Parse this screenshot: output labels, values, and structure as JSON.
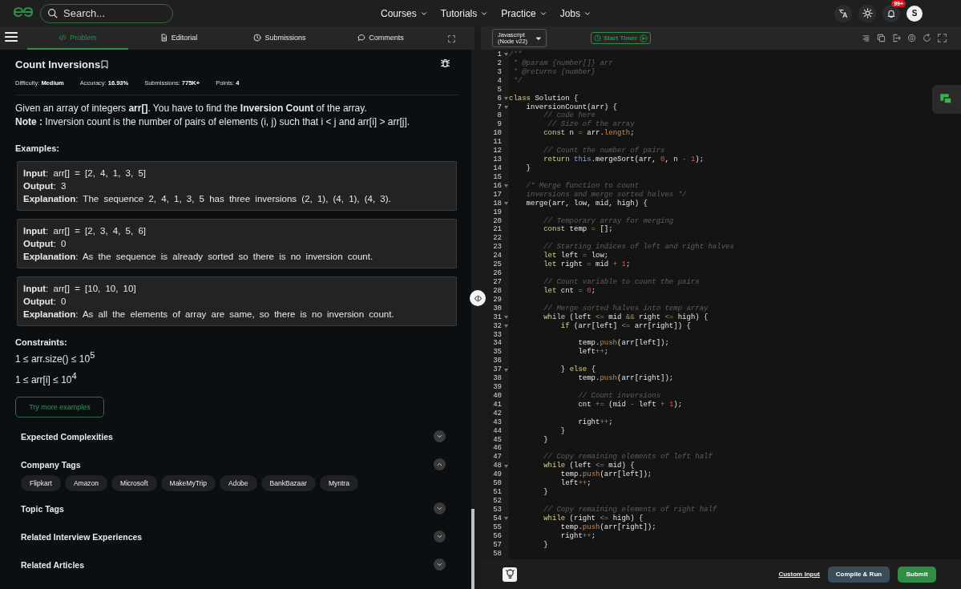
{
  "header": {
    "search": {
      "placeholder": "Search..."
    },
    "nav": [
      "Courses",
      "Tutorials",
      "Practice",
      "Jobs"
    ],
    "notifications_badge": "99+",
    "avatar": "S"
  },
  "problem_tabs": [
    {
      "label": "Problem",
      "selected": true,
      "kind": "code"
    },
    {
      "label": "Editorial",
      "selected": false,
      "kind": "doc"
    },
    {
      "label": "Submissions",
      "selected": false,
      "kind": "clock"
    },
    {
      "label": "Comments",
      "selected": false,
      "kind": "chat"
    }
  ],
  "problem": {
    "title": "Count Inversions",
    "meta": [
      "Difficulty: **Medium**",
      "Accuracy: **16.93%**",
      "Submissions: **775K+**",
      "Points: **4**"
    ],
    "description": [
      "Given an array of integers **arr[]**. You have to find the **Inversion Count** of the array.",
      "**Note :** Inversion count is the number of pairs of elements (i, j) such that i < j and arr[i] > arr[j]."
    ],
    "examples_heading": "Examples:",
    "examples": [
      [
        "**Input**: arr[] = [2, 4, 1, 3, 5]",
        "**Output**: 3",
        "**Explanation**: The sequence 2, 4, 1, 3, 5 has three inversions (2, 1), (4, 1), (4, 3)."
      ],
      [
        "**Input**: arr[] = [2, 3, 4, 5, 6]",
        "**Output**: 0",
        "**Explanation**: As the sequence is already sorted so there is no inversion count."
      ],
      [
        "**Input**: arr[] = [10, 10, 10]",
        "**Output**: 0",
        "**Explanation**: As all the elements of array are same, so there is no inversion count."
      ]
    ],
    "constraints_heading": "Constraints:",
    "constraints": [
      "1 ≤ arr.size() ≤ 10$^{5}$",
      "1 ≤ arr[i] ≤ 10$^{4}$"
    ],
    "try_button": "Try more examples",
    "sections": [
      {
        "title": "Expected Complexities",
        "expanded": false
      },
      {
        "title": "Company Tags",
        "expanded": true,
        "tags": [
          "Flipkart",
          "Amazon",
          "Microsoft",
          "MakeMyTrip",
          "Adobe",
          "BankBazaar",
          "Myntra"
        ]
      },
      {
        "title": "Topic Tags",
        "expanded": false
      },
      {
        "title": "Related Interview Experiences",
        "expanded": false
      },
      {
        "title": "Related Articles",
        "expanded": false
      }
    ]
  },
  "editor": {
    "language": "Javascript (Node v22)",
    "timer_button": "Start Timer",
    "lines": [
      {
        "number": "1",
        "foldable": true,
        "tokens": [
          {
            "text": "/**",
            "kind": "comment"
          }
        ]
      },
      {
        "number": "2",
        "foldable": false,
        "tokens": [
          {
            "text": " * @param {number[]} arr",
            "kind": "comment"
          }
        ]
      },
      {
        "number": "3",
        "foldable": false,
        "tokens": [
          {
            "text": " * @returns {number}",
            "kind": "comment"
          }
        ]
      },
      {
        "number": "4",
        "foldable": false,
        "tokens": [
          {
            "text": " */",
            "kind": "comment"
          }
        ]
      },
      {
        "number": "5",
        "foldable": false
      },
      {
        "number": "6",
        "foldable": true,
        "tokens": [
          {
            "text": "class",
            "kind": "keyword"
          },
          {
            "text": " Solution {"
          }
        ]
      },
      {
        "number": "7",
        "foldable": true,
        "tokens": [
          {
            "text": "    inversionCount(arr) {"
          }
        ]
      },
      {
        "number": "8",
        "foldable": false,
        "tokens": [
          {
            "text": "        // code here",
            "kind": "comment"
          }
        ]
      },
      {
        "number": "9",
        "foldable": false,
        "tokens": [
          {
            "text": "         // Size of the array",
            "kind": "comment"
          }
        ]
      },
      {
        "number": "10",
        "foldable": false,
        "tokens": [
          {
            "text": "        const",
            "kind": "keyword"
          },
          {
            "text": " n "
          },
          {
            "text": "=",
            "kind": "operator"
          },
          {
            "text": " arr."
          },
          {
            "text": "length",
            "kind": "member"
          },
          {
            "text": ";"
          }
        ]
      },
      {
        "number": "11",
        "foldable": false
      },
      {
        "number": "12",
        "foldable": false,
        "tokens": [
          {
            "text": "        // Count the number of pairs",
            "kind": "comment"
          }
        ]
      },
      {
        "number": "13",
        "foldable": false,
        "tokens": [
          {
            "text": "        return ",
            "kind": "keyword"
          },
          {
            "text": "this",
            "kind": "self"
          },
          {
            "text": ".mergeSort(arr, "
          },
          {
            "text": "0",
            "kind": "number"
          },
          {
            "text": ", n "
          },
          {
            "text": "- ",
            "kind": "operator"
          },
          {
            "text": "1",
            "kind": "number"
          },
          {
            "text": ");"
          }
        ]
      },
      {
        "number": "14",
        "foldable": false,
        "tokens": [
          {
            "text": "    }"
          }
        ]
      },
      {
        "number": "15",
        "foldable": false
      },
      {
        "number": "16",
        "foldable": true,
        "tokens": [
          {
            "text": "    /* Merge function to count",
            "kind": "comment"
          }
        ]
      },
      {
        "number": "17",
        "foldable": false,
        "tokens": [
          {
            "text": "    inversions and merge sorted halves */",
            "kind": "comment"
          }
        ]
      },
      {
        "number": "18",
        "foldable": true,
        "tokens": [
          {
            "text": "    merge(arr, low, mid, high) {"
          }
        ]
      },
      {
        "number": "19",
        "foldable": false
      },
      {
        "number": "20",
        "foldable": false,
        "tokens": [
          {
            "text": "        // Temporary array for merging",
            "kind": "comment"
          }
        ]
      },
      {
        "number": "21",
        "foldable": false,
        "tokens": [
          {
            "text": "        const",
            "kind": "keyword"
          },
          {
            "text": " temp "
          },
          {
            "text": "=",
            "kind": "operator"
          },
          {
            "text": " [];"
          }
        ]
      },
      {
        "number": "22",
        "foldable": false
      },
      {
        "number": "23",
        "foldable": false,
        "tokens": [
          {
            "text": "        // Starting indices of left and right halves",
            "kind": "comment"
          }
        ]
      },
      {
        "number": "24",
        "foldable": false,
        "tokens": [
          {
            "text": "        let",
            "kind": "keyword"
          },
          {
            "text": " left "
          },
          {
            "text": "=",
            "kind": "operator"
          },
          {
            "text": " low;"
          }
        ]
      },
      {
        "number": "25",
        "foldable": false,
        "tokens": [
          {
            "text": "        let",
            "kind": "keyword"
          },
          {
            "text": " right "
          },
          {
            "text": "=",
            "kind": "operator"
          },
          {
            "text": " mid "
          },
          {
            "text": "+ ",
            "kind": "operator"
          },
          {
            "text": "1",
            "kind": "number"
          },
          {
            "text": ";"
          }
        ]
      },
      {
        "number": "26",
        "foldable": false
      },
      {
        "number": "27",
        "foldable": false,
        "tokens": [
          {
            "text": "        // Count variable to count the pairs",
            "kind": "comment"
          }
        ]
      },
      {
        "number": "28",
        "foldable": false,
        "tokens": [
          {
            "text": "        let",
            "kind": "keyword"
          },
          {
            "text": " cnt "
          },
          {
            "text": "= ",
            "kind": "operator"
          },
          {
            "text": "0",
            "kind": "number"
          },
          {
            "text": ";"
          }
        ]
      },
      {
        "number": "29",
        "foldable": false
      },
      {
        "number": "30",
        "foldable": false,
        "tokens": [
          {
            "text": "        // Merge sorted halves into temp array",
            "kind": "comment"
          }
        ]
      },
      {
        "number": "31",
        "foldable": true,
        "tokens": [
          {
            "text": "        while",
            "kind": "keyword"
          },
          {
            "text": " (left "
          },
          {
            "text": "<=",
            "kind": "operator"
          },
          {
            "text": " mid "
          },
          {
            "text": "&&",
            "kind": "operator"
          },
          {
            "text": " right "
          },
          {
            "text": "<=",
            "kind": "operator"
          },
          {
            "text": " high) {"
          }
        ]
      },
      {
        "number": "32",
        "foldable": true,
        "tokens": [
          {
            "text": "            if",
            "kind": "keyword"
          },
          {
            "text": " (arr[left] "
          },
          {
            "text": "<=",
            "kind": "operator"
          },
          {
            "text": " arr[right]) {"
          }
        ]
      },
      {
        "number": "33",
        "foldable": false
      },
      {
        "number": "34",
        "foldable": false,
        "tokens": [
          {
            "text": "                temp."
          },
          {
            "text": "push",
            "kind": "member"
          },
          {
            "text": "(arr[left]);"
          }
        ]
      },
      {
        "number": "35",
        "foldable": false,
        "tokens": [
          {
            "text": "                left"
          },
          {
            "text": "++",
            "kind": "operator"
          },
          {
            "text": ";"
          }
        ]
      },
      {
        "number": "36",
        "foldable": false
      },
      {
        "number": "37",
        "foldable": true,
        "tokens": [
          {
            "text": "            } "
          },
          {
            "text": "else",
            "kind": "keyword"
          },
          {
            "text": " {"
          }
        ]
      },
      {
        "number": "38",
        "foldable": false,
        "tokens": [
          {
            "text": "                temp."
          },
          {
            "text": "push",
            "kind": "member"
          },
          {
            "text": "(arr[right]);"
          }
        ]
      },
      {
        "number": "39",
        "foldable": false
      },
      {
        "number": "40",
        "foldable": false,
        "tokens": [
          {
            "text": "                // Count inversions",
            "kind": "comment"
          }
        ]
      },
      {
        "number": "41",
        "foldable": false,
        "tokens": [
          {
            "text": "                cnt "
          },
          {
            "text": "+=",
            "kind": "operator"
          },
          {
            "text": " (mid "
          },
          {
            "text": "-",
            "kind": "operator"
          },
          {
            "text": " left "
          },
          {
            "text": "+ ",
            "kind": "operator"
          },
          {
            "text": "1",
            "kind": "number"
          },
          {
            "text": ");"
          }
        ]
      },
      {
        "number": "42",
        "foldable": false
      },
      {
        "number": "43",
        "foldable": false,
        "tokens": [
          {
            "text": "                right"
          },
          {
            "text": "++",
            "kind": "operator"
          },
          {
            "text": ";"
          }
        ]
      },
      {
        "number": "44",
        "foldable": false,
        "tokens": [
          {
            "text": "            }"
          }
        ]
      },
      {
        "number": "45",
        "foldable": false,
        "tokens": [
          {
            "text": "        }"
          }
        ]
      },
      {
        "number": "46",
        "foldable": false
      },
      {
        "number": "47",
        "foldable": false,
        "tokens": [
          {
            "text": "        // Copy remaining elements of left half",
            "kind": "comment"
          }
        ]
      },
      {
        "number": "48",
        "foldable": true,
        "tokens": [
          {
            "text": "        while",
            "kind": "keyword"
          },
          {
            "text": " (left "
          },
          {
            "text": "<=",
            "kind": "operator"
          },
          {
            "text": " mid) {"
          }
        ]
      },
      {
        "number": "49",
        "foldable": false,
        "tokens": [
          {
            "text": "            temp."
          },
          {
            "text": "push",
            "kind": "member"
          },
          {
            "text": "(arr[left]);"
          }
        ]
      },
      {
        "number": "50",
        "foldable": false,
        "tokens": [
          {
            "text": "            left"
          },
          {
            "text": "++",
            "kind": "operator"
          },
          {
            "text": ";"
          }
        ]
      },
      {
        "number": "51",
        "foldable": false,
        "tokens": [
          {
            "text": "        }"
          }
        ]
      },
      {
        "number": "52",
        "foldable": false
      },
      {
        "number": "53",
        "foldable": false,
        "tokens": [
          {
            "text": "        // Copy remaining elements of right half",
            "kind": "comment"
          }
        ]
      },
      {
        "number": "54",
        "foldable": true,
        "tokens": [
          {
            "text": "        while",
            "kind": "keyword"
          },
          {
            "text": " (right "
          },
          {
            "text": "<=",
            "kind": "operator"
          },
          {
            "text": " high) {"
          }
        ]
      },
      {
        "number": "55",
        "foldable": false,
        "tokens": [
          {
            "text": "            temp."
          },
          {
            "text": "push",
            "kind": "member"
          },
          {
            "text": "(arr[right]);"
          }
        ]
      },
      {
        "number": "56",
        "foldable": false,
        "tokens": [
          {
            "text": "            right"
          },
          {
            "text": "++",
            "kind": "operator"
          },
          {
            "text": ";"
          }
        ]
      },
      {
        "number": "57",
        "foldable": false,
        "tokens": [
          {
            "text": "        }"
          }
        ]
      },
      {
        "number": "58",
        "foldable": false
      }
    ],
    "footer": {
      "custom_input": "Custom Input",
      "compile_button": "Compile & Run",
      "submit_button": "Submit"
    }
  }
}
